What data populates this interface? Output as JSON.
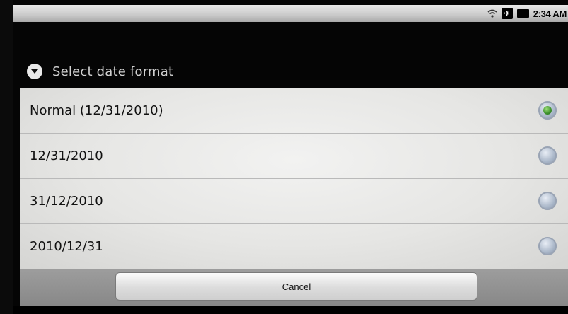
{
  "status_bar": {
    "time": "2:34 AM",
    "icons": [
      "wifi-icon",
      "airplane-icon",
      "battery-icon"
    ]
  },
  "dialog": {
    "title": "Select date format",
    "title_icon": "dropdown-circle-icon",
    "options": [
      {
        "label": "Normal (12/31/2010)",
        "selected": true
      },
      {
        "label": "12/31/2010",
        "selected": false
      },
      {
        "label": "31/12/2010",
        "selected": false
      },
      {
        "label": "2010/12/31",
        "selected": false
      }
    ],
    "cancel_label": "Cancel"
  },
  "colors": {
    "selected_radio": "#3b8f2b",
    "list_background": "#e6e6e4",
    "title_text": "#d0d0d0"
  }
}
